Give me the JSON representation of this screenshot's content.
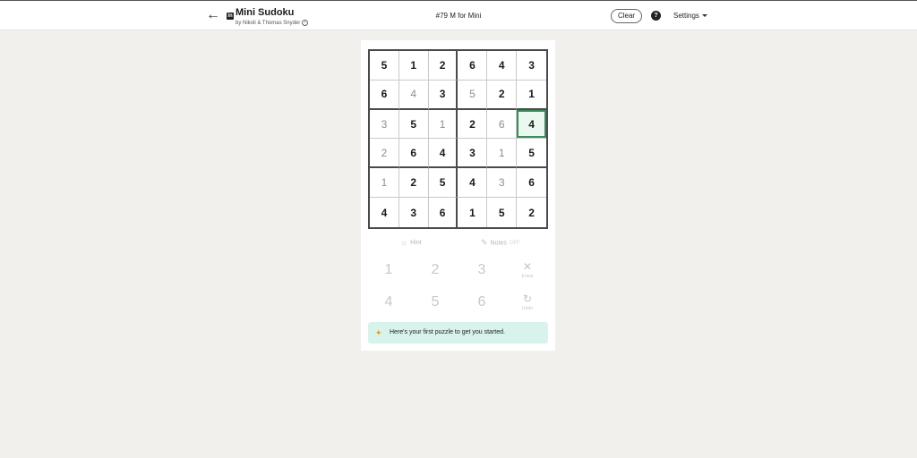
{
  "header": {
    "back_icon": "arrow-left-icon",
    "logo_text": "in",
    "app_title": "Mini Sudoku",
    "byline": "by Nikoli & Thomas Snyder",
    "info_icon": "i",
    "puzzle_title": "#79 M for Mini",
    "clear_label": "Clear",
    "help_glyph": "?",
    "settings_label": "Settings"
  },
  "board": {
    "rows": [
      [
        {
          "v": "5",
          "given": true
        },
        {
          "v": "1",
          "given": true
        },
        {
          "v": "2",
          "given": true
        },
        {
          "v": "6",
          "given": true
        },
        {
          "v": "4",
          "given": true
        },
        {
          "v": "3",
          "given": true
        }
      ],
      [
        {
          "v": "6",
          "given": true
        },
        {
          "v": "4",
          "given": false
        },
        {
          "v": "3",
          "given": true
        },
        {
          "v": "5",
          "given": false
        },
        {
          "v": "2",
          "given": true
        },
        {
          "v": "1",
          "given": true
        }
      ],
      [
        {
          "v": "3",
          "given": false
        },
        {
          "v": "5",
          "given": true
        },
        {
          "v": "1",
          "given": false
        },
        {
          "v": "2",
          "given": true
        },
        {
          "v": "6",
          "given": false
        },
        {
          "v": "4",
          "given": true,
          "selected": true
        }
      ],
      [
        {
          "v": "2",
          "given": false
        },
        {
          "v": "6",
          "given": true
        },
        {
          "v": "4",
          "given": true
        },
        {
          "v": "3",
          "given": true
        },
        {
          "v": "1",
          "given": false
        },
        {
          "v": "5",
          "given": true
        }
      ],
      [
        {
          "v": "1",
          "given": false
        },
        {
          "v": "2",
          "given": true
        },
        {
          "v": "5",
          "given": true
        },
        {
          "v": "4",
          "given": true
        },
        {
          "v": "3",
          "given": false
        },
        {
          "v": "6",
          "given": true
        }
      ],
      [
        {
          "v": "4",
          "given": true
        },
        {
          "v": "3",
          "given": true
        },
        {
          "v": "6",
          "given": true
        },
        {
          "v": "1",
          "given": true
        },
        {
          "v": "5",
          "given": true
        },
        {
          "v": "2",
          "given": true
        }
      ]
    ]
  },
  "tools": {
    "hint_label": "Hint",
    "notes_label": "Notes",
    "notes_state": "OFF"
  },
  "pad": {
    "keys": [
      "1",
      "2",
      "3",
      "4",
      "5",
      "6"
    ],
    "erase_label": "Erase",
    "undo_label": "Undo"
  },
  "banner": {
    "text": "Here's your first puzzle to get you started."
  },
  "colors": {
    "selected_border": "#3c8a5a",
    "banner_bg": "#d7f3ec",
    "page_bg": "#f2f0ec"
  }
}
